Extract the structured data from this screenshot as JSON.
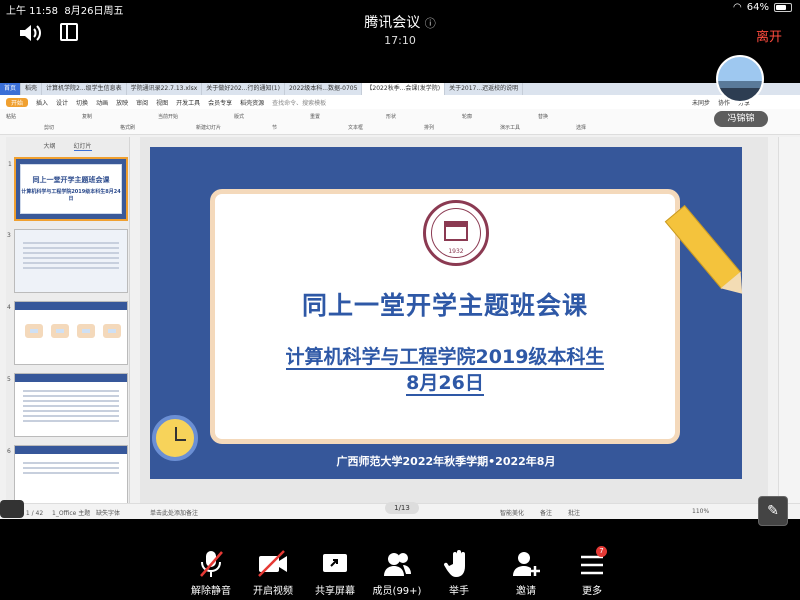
{
  "status_bar": {
    "time": "上午 11:58",
    "date": "8月26日周五",
    "battery": "64%"
  },
  "meeting": {
    "title": "腾讯会议",
    "timer": "17:10",
    "leave_label": "离开"
  },
  "browser_tabs": [
    {
      "label": "首页"
    },
    {
      "label": "稻壳"
    },
    {
      "label": "计算机学院2...级学生信息表"
    },
    {
      "label": "学院通讯录22.7.13.xlsx"
    },
    {
      "label": "关于做好202...行的通知(1)"
    },
    {
      "label": "2022级本科...数据-0705"
    },
    {
      "label": "【2022秋季...会课(发学院)"
    },
    {
      "label": "关于2017...迟返校的说明"
    }
  ],
  "menu": {
    "items": [
      "开始",
      "插入",
      "设计",
      "切换",
      "动画",
      "放映",
      "审阅",
      "视图",
      "开发工具",
      "会员专享",
      "稻壳资源"
    ],
    "find_label": "查找命令、搜索模板",
    "right_items": [
      "未同步",
      "协作",
      "分享"
    ]
  },
  "toolbar": {
    "items": [
      "粘贴",
      "剪切",
      "复制",
      "格式刷",
      "当前开始",
      "新建幻灯片",
      "版式",
      "节",
      "重置",
      "文本框",
      "形状",
      "排列",
      "轮廓",
      "演示工具",
      "替换",
      "选择"
    ]
  },
  "panel": {
    "tabs": [
      "大纲",
      "幻灯片"
    ],
    "slide_numbers": [
      "1",
      "3",
      "4",
      "5",
      "6"
    ],
    "thumb1_title": "同上一堂开学主题班会课",
    "thumb1_sub": "计算机科学与工程学院2019级本科生8月24日"
  },
  "slide": {
    "seal_year": "1932",
    "title": "同上一堂开学主题班会课",
    "subtitle_line1": "计算机科学与工程学院2019级本科生",
    "subtitle_line2": "8月26日",
    "footer": "广西师范大学2022年秋季学期•2022年8月"
  },
  "status_line": {
    "slide_info": "幻灯片 1 / 42",
    "theme": "1_Office 主题",
    "font": "缺失字体",
    "notes": "单击此处添加备注",
    "beautify": "智能美化",
    "remarks": "备注",
    "comments": "批注",
    "zoom": "110%"
  },
  "page_indicator": "1/13",
  "participant": {
    "name": "冯锦锦"
  },
  "bottom_bar": [
    {
      "label": "解除静音",
      "icon": "mic-muted-icon"
    },
    {
      "label": "开启视频",
      "icon": "video-off-icon"
    },
    {
      "label": "共享屏幕",
      "icon": "share-screen-icon"
    },
    {
      "label": "成员(99+)",
      "icon": "members-icon"
    },
    {
      "label": "举手",
      "icon": "raise-hand-icon"
    },
    {
      "label": "邀请",
      "icon": "invite-icon"
    },
    {
      "label": "更多",
      "icon": "more-icon",
      "badge": "7"
    }
  ]
}
